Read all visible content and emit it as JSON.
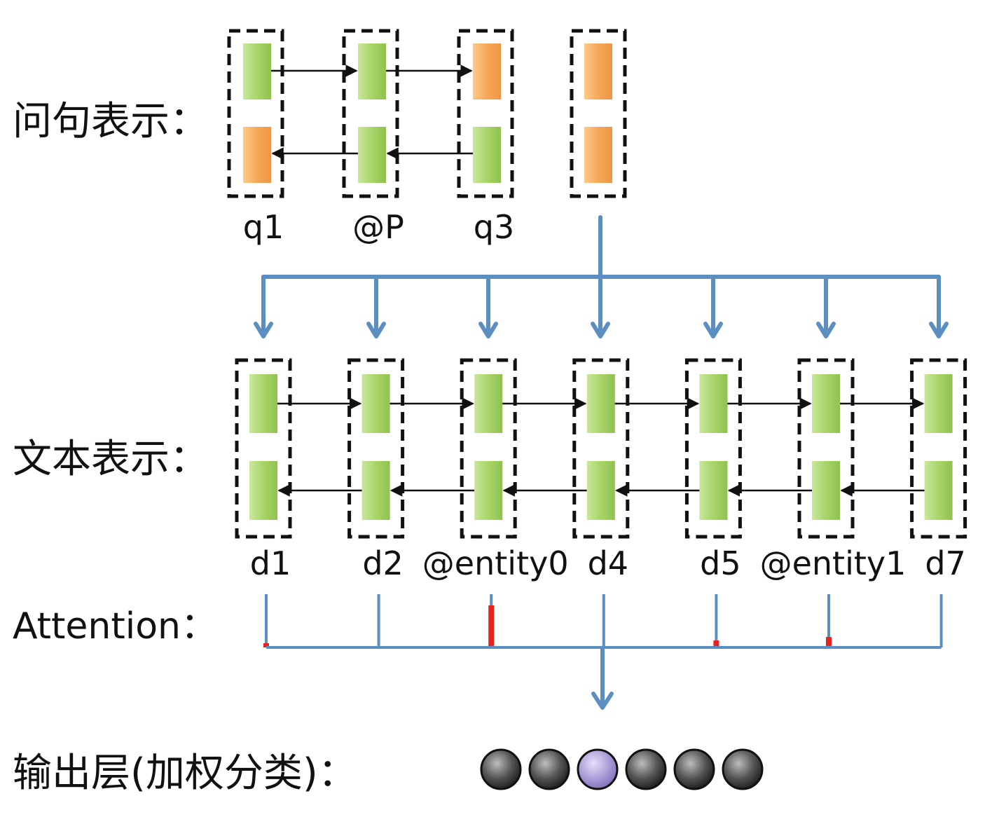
{
  "labels": {
    "question": "问句表示：",
    "document": "文本表示：",
    "attention": "Attention：",
    "output": "输出层(加权分类)："
  },
  "question_tokens": [
    "q1",
    "@P",
    "q3"
  ],
  "document_tokens": [
    "d1",
    "d2",
    "@entity0",
    "d4",
    "d5",
    "@entity1",
    "d7"
  ],
  "attention_weights": [
    0.05,
    0.0,
    0.6,
    0.0,
    0.1,
    0.15,
    0.0
  ],
  "question_cells": {
    "forward": [
      "green",
      "green",
      "orange"
    ],
    "backward": [
      "orange",
      "green",
      "green"
    ],
    "final": [
      "orange",
      "orange"
    ]
  },
  "output_nodes": [
    "gray",
    "gray",
    "purple",
    "gray",
    "gray",
    "gray"
  ],
  "colors": {
    "green": "#a9d46a",
    "orange": "#f5a85a",
    "blue_connector": "#5b8fc2",
    "attention_red": "#e8231f",
    "output_gray": "#333333",
    "output_purple": "#a898d6"
  }
}
